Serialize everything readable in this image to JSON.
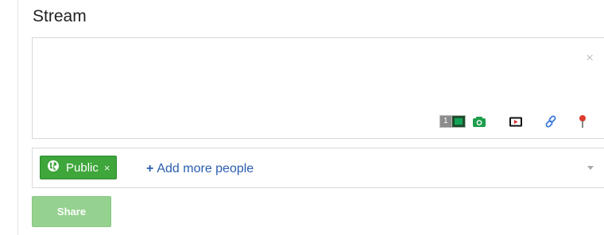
{
  "header": {
    "title": "Stream"
  },
  "compose": {
    "close_label": "×",
    "photo_count": "1",
    "attachments": [
      {
        "icon": "camera-icon"
      },
      {
        "icon": "video-icon"
      },
      {
        "icon": "link-icon"
      },
      {
        "icon": "location-pin-icon"
      }
    ]
  },
  "audience": {
    "chip_label": "Public",
    "chip_remove": "×",
    "add_plus": "+",
    "add_label": "Add more people"
  },
  "actions": {
    "share_label": "Share"
  },
  "colors": {
    "accent_green": "#3ea63a",
    "share_disabled": "#95d18f",
    "link_blue": "#2a5db0",
    "pin_red": "#dd3b2e"
  }
}
